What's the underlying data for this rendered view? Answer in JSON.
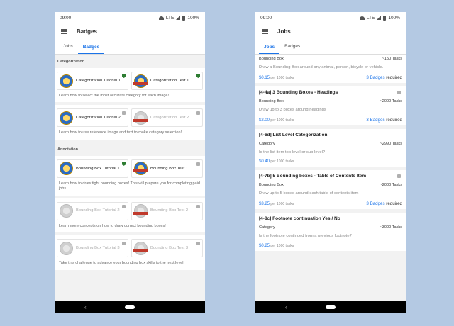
{
  "status": {
    "time": "09:00",
    "network": "LTE",
    "battery": "100%"
  },
  "left": {
    "title": "Badges",
    "tabs": [
      "Jobs",
      "Badges"
    ],
    "sections": [
      {
        "header": "Categorization",
        "groups": [
          {
            "badges": [
              {
                "name": "Categorization Tutorial 1",
                "state": "earned"
              },
              {
                "name": "Categorization Test 1",
                "state": "earned"
              }
            ],
            "description": "Learn how to select the most accurate category for each image!"
          },
          {
            "badges": [
              {
                "name": "Categorization Tutorial 2",
                "state": "unlocked"
              },
              {
                "name": "Categorization Test 2",
                "state": "locked"
              }
            ],
            "description": "Learn how to use reference image and text to make category selection!"
          }
        ]
      },
      {
        "header": "Annotation",
        "groups": [
          {
            "badges": [
              {
                "name": "Bounding Box Tutorial 1",
                "state": "earned"
              },
              {
                "name": "Bounding Box Test 1",
                "state": "unlocked"
              }
            ],
            "description": "Learn how to draw tight bounding boxes! This will prepare you for completing paid jobs."
          },
          {
            "badges": [
              {
                "name": "Bounding Box Tutorial 2",
                "state": "locked"
              },
              {
                "name": "Bounding Box Test 2",
                "state": "locked"
              }
            ],
            "description": "Learn more concepts on how to draw correct bounding boxes!"
          },
          {
            "badges": [
              {
                "name": "Bounding Box Tutorial 3",
                "state": "locked"
              },
              {
                "name": "Bounding Box Test 3",
                "state": "locked"
              }
            ],
            "description": "Take this challenge to advance your bounding box skills to the next level!"
          }
        ]
      }
    ]
  },
  "right": {
    "title": "Jobs",
    "tabs": [
      "Jobs",
      "Badges"
    ],
    "jobs": [
      {
        "title": "",
        "category": "Bounding Box",
        "tasks": "~150 Tasks",
        "description": "Draw a Bounding Box around any animal, person, bicycle or vehicle.",
        "price": "$0.15",
        "per": "per 1000 tasks",
        "badges_count": "3 Badges",
        "badges_suffix": "required",
        "locked": false
      },
      {
        "title": "[4-4a] 3 Bounding Boxes - Headings",
        "category": "Bounding Box",
        "tasks": "~2000 Tasks",
        "description": "Draw up to 3 boxes around headings",
        "price": "$2.00",
        "per": "per 1000 tasks",
        "badges_count": "3 Badges",
        "badges_suffix": "required",
        "locked": true
      },
      {
        "title": "[4-6d] List Level Categorization",
        "category": "Category",
        "tasks": "~2990 Tasks",
        "description": "Is the list item top level or sub level?",
        "price": "$0.40",
        "per": "per 1000 tasks",
        "badges_count": "",
        "badges_suffix": "",
        "locked": false
      },
      {
        "title": "[4-7b] 5 Bounding boxes - Table of Contents Item",
        "category": "Bounding Box",
        "tasks": "~2000 Tasks",
        "description": "Draw up to 5 boxes around each table of contents item",
        "price": "$3.25",
        "per": "per 1000 tasks",
        "badges_count": "3 Badges",
        "badges_suffix": "required",
        "locked": true
      },
      {
        "title": "[4-8c] Footnote continuation Yes / No",
        "category": "Category",
        "tasks": "~3000 Tasks",
        "description": "Is the footnote continued from a previous footnote?",
        "price": "$0.25",
        "per": "per 1000 tasks",
        "badges_count": "",
        "badges_suffix": "",
        "locked": false
      }
    ]
  },
  "nav": {
    "back_glyph": "‹"
  },
  "colors": {
    "accent": "#1a73e8",
    "background": "#b4c9e3"
  }
}
